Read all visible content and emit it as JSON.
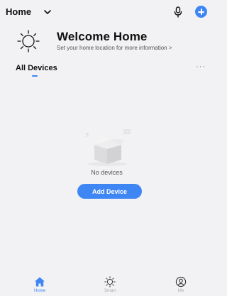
{
  "header": {
    "home_name": "Home",
    "accent_color": "#3f86f5"
  },
  "welcome": {
    "title": "Welcome Home",
    "subtitle": "Set your home location for more information >"
  },
  "devices": {
    "title": "All Devices",
    "more": "···",
    "empty_text": "No devices",
    "add_label": "Add Device"
  },
  "tabs": [
    {
      "label": "Home",
      "icon": "home-icon",
      "active": true
    },
    {
      "label": "Smart",
      "icon": "sun-icon",
      "active": false
    },
    {
      "label": "Me",
      "icon": "profile-icon",
      "active": false
    }
  ]
}
